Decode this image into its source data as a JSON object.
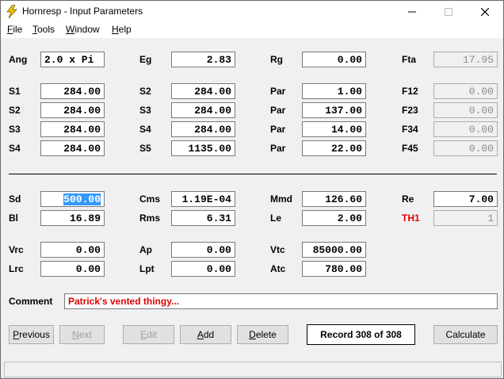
{
  "window": {
    "title": "Hornresp - Input Parameters"
  },
  "menu": [
    {
      "key": "F",
      "rest": "ile"
    },
    {
      "key": "T",
      "rest": "ools"
    },
    {
      "key": "W",
      "rest": "indow"
    },
    {
      "key": "H",
      "rest": "elp"
    }
  ],
  "params": {
    "Ang": {
      "label": "Ang",
      "value": "2.0 x Pi"
    },
    "Eg": {
      "label": "Eg",
      "value": "2.83"
    },
    "Rg": {
      "label": "Rg",
      "value": "0.00"
    },
    "Fta": {
      "label": "Fta",
      "value": "17.95"
    },
    "S1": {
      "label": "S1",
      "value": "284.00"
    },
    "S2a": {
      "label": "S2",
      "value": "284.00"
    },
    "Par1": {
      "label": "Par",
      "value": "1.00"
    },
    "F12": {
      "label": "F12",
      "value": "0.00"
    },
    "S2b": {
      "label": "S2",
      "value": "284.00"
    },
    "S3a": {
      "label": "S3",
      "value": "284.00"
    },
    "Par2": {
      "label": "Par",
      "value": "137.00"
    },
    "F23": {
      "label": "F23",
      "value": "0.00"
    },
    "S3b": {
      "label": "S3",
      "value": "284.00"
    },
    "S4a": {
      "label": "S4",
      "value": "284.00"
    },
    "Par3": {
      "label": "Par",
      "value": "14.00"
    },
    "F34": {
      "label": "F34",
      "value": "0.00"
    },
    "S4b": {
      "label": "S4",
      "value": "284.00"
    },
    "S5": {
      "label": "S5",
      "value": "1135.00"
    },
    "Par4": {
      "label": "Par",
      "value": "22.00"
    },
    "F45": {
      "label": "F45",
      "value": "0.00"
    },
    "Sd": {
      "label": "Sd",
      "value": "500.00"
    },
    "Cms": {
      "label": "Cms",
      "value": "1.19E-04"
    },
    "Mmd": {
      "label": "Mmd",
      "value": "126.60"
    },
    "Re": {
      "label": "Re",
      "value": "7.00"
    },
    "Bl": {
      "label": "Bl",
      "value": "16.89"
    },
    "Rms": {
      "label": "Rms",
      "value": "6.31"
    },
    "Le": {
      "label": "Le",
      "value": "2.00"
    },
    "TH1": {
      "label": "TH1",
      "value": "1"
    },
    "Vrc": {
      "label": "Vrc",
      "value": "0.00"
    },
    "Ap": {
      "label": "Ap",
      "value": "0.00"
    },
    "Vtc": {
      "label": "Vtc",
      "value": "85000.00"
    },
    "Lrc": {
      "label": "Lrc",
      "value": "0.00"
    },
    "Lpt": {
      "label": "Lpt",
      "value": "0.00"
    },
    "Atc": {
      "label": "Atc",
      "value": "780.00"
    }
  },
  "comment": {
    "label": "Comment",
    "value": "Patrick's vented thingy..."
  },
  "buttons": {
    "previous": {
      "key": "P",
      "rest": "revious"
    },
    "next": {
      "key": "N",
      "rest": "ext"
    },
    "edit": {
      "key": "E",
      "rest": "dit"
    },
    "add": {
      "key": "A",
      "rest": "dd"
    },
    "delete": {
      "key": "D",
      "rest": "elete"
    },
    "record": "Record 308 of 308",
    "calculate": "Calculate"
  },
  "colors": {
    "th1_label": "#e00000",
    "comment_text": "#e00000",
    "selection": "#3399ff",
    "icon": "#f5c400"
  },
  "icons": {
    "app": "lightning-bolt-icon",
    "minimize": "minimize-icon",
    "maximize": "maximize-icon",
    "close": "close-icon"
  }
}
